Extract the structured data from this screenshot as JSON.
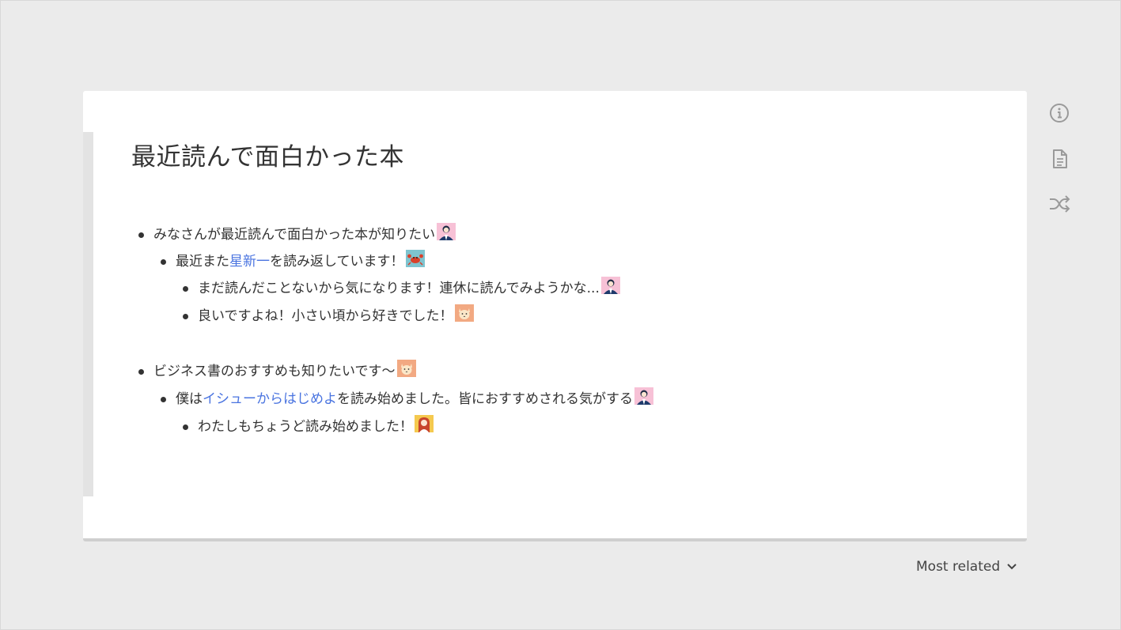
{
  "post": {
    "title": "最近読んで面白かった本"
  },
  "thread1": {
    "comment1": {
      "text": "みなさんが最近読んで面白かった本が知りたい",
      "avatar": "man-navy-suit-pink-bg"
    },
    "comment2": {
      "text_before": "最近また",
      "link": "星新一",
      "text_after": "を読み返しています！",
      "avatar": "crab-teal-bg"
    },
    "comment3": {
      "text": "まだ読んだことないから気になります！連休に読んでみようかな...",
      "avatar": "man-navy-suit-pink-bg"
    },
    "comment4": {
      "text": "良いですよね！小さい頃から好きでした！",
      "avatar": "cat-orange-bg"
    }
  },
  "thread2": {
    "comment1": {
      "text": "ビジネス書のおすすめも知りたいです〜",
      "avatar": "cat-orange-bg"
    },
    "comment2": {
      "text_before": "僕は",
      "link": "イシューからはじめよ",
      "text_after": "を読み始めました。皆におすすめされる気がする",
      "avatar": "man-navy-suit-pink-bg"
    },
    "comment3": {
      "text": "わたしもちょうど読み始めました！",
      "avatar": "woman-red-hair-yellow-bg"
    }
  },
  "sidebar": {
    "icons": [
      "info-icon",
      "document-icon",
      "shuffle-icon"
    ]
  },
  "sort": {
    "label": "Most related",
    "icon": "chevron-down-icon"
  },
  "colors": {
    "background": "#ebebeb",
    "card": "#ffffff",
    "link": "#4a74e0",
    "text": "#333333",
    "icon": "#9a9a9a"
  }
}
